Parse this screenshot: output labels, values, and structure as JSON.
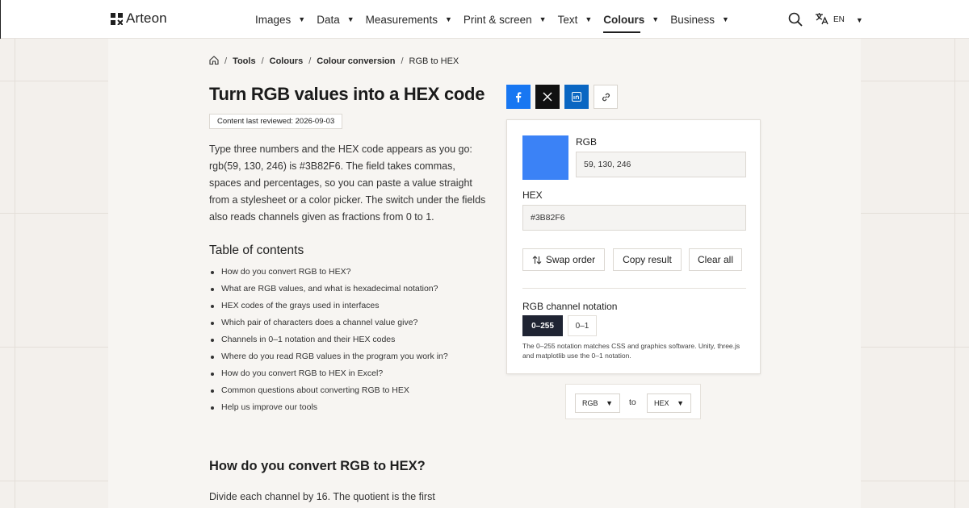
{
  "brand": {
    "name": "Arteon"
  },
  "nav": {
    "items": [
      {
        "label": "Images",
        "active": false
      },
      {
        "label": "Data",
        "active": false
      },
      {
        "label": "Measurements",
        "active": false
      },
      {
        "label": "Print & screen",
        "active": false
      },
      {
        "label": "Text",
        "active": false
      },
      {
        "label": "Colours",
        "active": true
      },
      {
        "label": "Business",
        "active": false
      }
    ],
    "language": "EN"
  },
  "breadcrumb": {
    "items": [
      "Tools",
      "Colours",
      "Colour conversion"
    ],
    "current": "RGB to HEX"
  },
  "page": {
    "title": "Turn RGB values into a HEX code",
    "reviewed": "Content last reviewed: 2026-09-03",
    "intro": "Type three numbers and the HEX code appears as you go: rgb(59, 130, 246) is #3B82F6. The field takes commas, spaces and percentages, so you can paste a value straight from a stylesheet or a color picker. The switch under the fields also reads channels given as fractions from 0 to 1.",
    "toc_title": "Table of contents",
    "toc": [
      "How do you convert RGB to HEX?",
      "What are RGB values, and what is hexadecimal notation?",
      "HEX codes of the grays used in interfaces",
      "Which pair of characters does a channel value give?",
      "Channels in 0–1 notation and their HEX codes",
      "Where do you read RGB values in the program you work in?",
      "How do you convert RGB to HEX in Excel?",
      "Common questions about converting RGB to HEX",
      "Help us improve our tools"
    ],
    "section_heading": "How do you convert RGB to HEX?",
    "section_text": "Divide each channel by 16. The quotient is the first"
  },
  "share": {
    "icons": [
      "facebook-icon",
      "x-icon",
      "linkedin-icon",
      "link-icon"
    ],
    "colors": {
      "facebook": "#1877f2",
      "x": "#111111",
      "linkedin": "#0a66c2"
    }
  },
  "converter": {
    "swatch_color": "#3B82F6",
    "rgb_label": "RGB",
    "rgb_value": "59, 130, 246",
    "hex_label": "HEX",
    "hex_value": "#3B82F6",
    "buttons": {
      "swap": "Swap order",
      "copy": "Copy result",
      "clear": "Clear all"
    },
    "notation_label": "RGB channel notation",
    "notation_options": [
      "0–255",
      "0–1"
    ],
    "notation_selected": "0–255",
    "note": "The 0–255 notation matches CSS and graphics software. Unity, three.js and matplotlib use the 0–1 notation."
  },
  "units": {
    "from": "RGB",
    "to_label": "to",
    "to": "HEX"
  }
}
